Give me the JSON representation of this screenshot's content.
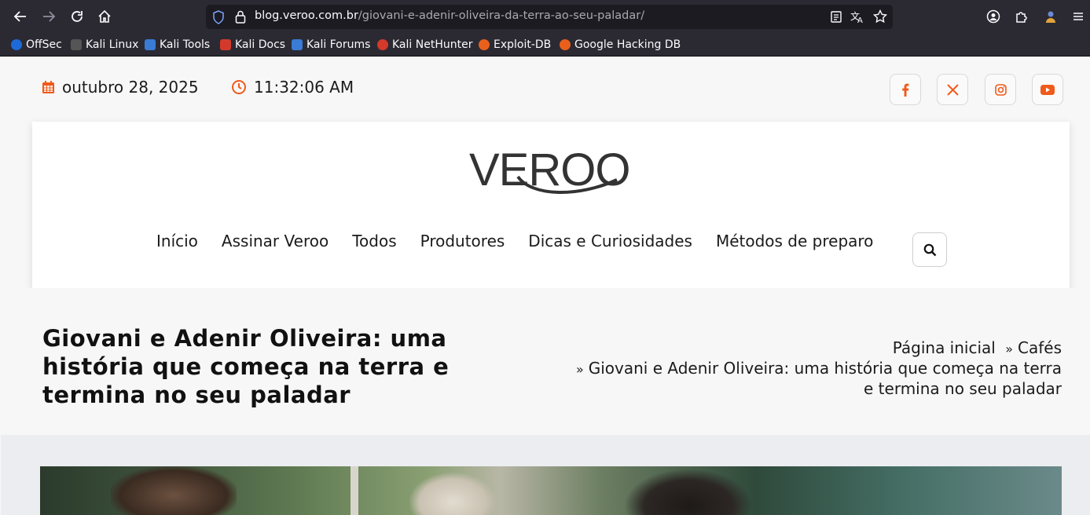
{
  "browser": {
    "url_domain": "blog.veroo.com.br",
    "url_path": "/giovani-e-adenir-oliveira-da-terra-ao-seu-paladar/",
    "bookmarks": [
      {
        "label": "OffSec",
        "color": "#1e6ad8"
      },
      {
        "label": "Kali Linux",
        "color": "#888888"
      },
      {
        "label": "Kali Tools",
        "color": "#3a7bd5"
      },
      {
        "label": "Kali Docs",
        "color": "#d33a2c"
      },
      {
        "label": "Kali Forums",
        "color": "#3a7bd5"
      },
      {
        "label": "Kali NetHunter",
        "color": "#d33a2c"
      },
      {
        "label": "Exploit-DB",
        "color": "#e8601c"
      },
      {
        "label": "Google Hacking DB",
        "color": "#e8601c"
      }
    ]
  },
  "topbar": {
    "date": "outubro 28, 2025",
    "time": "11:32:06 AM",
    "accent": "#f05a1a",
    "socials": [
      "facebook-icon",
      "x-icon",
      "instagram-icon",
      "youtube-icon"
    ]
  },
  "site": {
    "logo": "VEROO",
    "nav": [
      "Início",
      "Assinar Veroo",
      "Todos",
      "Produtores",
      "Dicas e Curiosidades",
      "Métodos de preparo"
    ]
  },
  "post": {
    "title": "Giovani e Adenir Oliveira: uma história que começa na terra e termina no seu paladar",
    "breadcrumb": {
      "home": "Página inicial",
      "category": "Cafés",
      "current": "Giovani e Adenir Oliveira: uma história que começa na terra e termina no seu paladar",
      "separator": "»"
    }
  }
}
